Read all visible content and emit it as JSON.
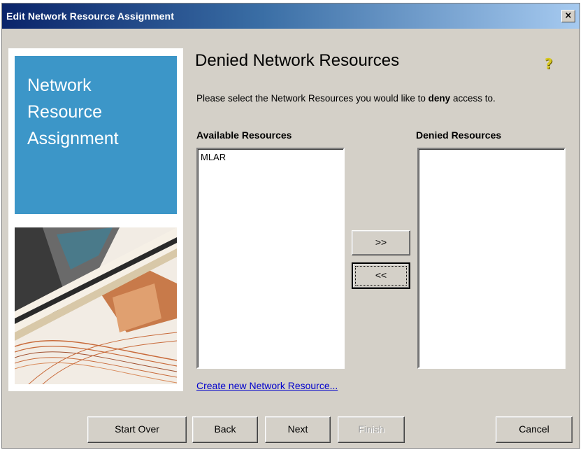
{
  "window": {
    "title": "Edit Network Resource Assignment",
    "close_glyph": "×"
  },
  "side_panel": {
    "title_lines": [
      "Network",
      "Resource",
      "Assignment"
    ]
  },
  "content": {
    "heading": "Denied Network Resources",
    "description_prefix": "Please select the Network Resources you would like to ",
    "description_bold": "deny",
    "description_suffix": " access to.",
    "available_label": "Available Resources",
    "denied_label": "Denied Resources",
    "available_items": [
      "MLAR"
    ],
    "denied_items": [],
    "add_button": ">>",
    "remove_button": "<<",
    "create_link": "Create new Network Resource..."
  },
  "footer": {
    "start_over": "Start Over",
    "back": "Back",
    "next": "Next",
    "finish": "Finish",
    "cancel": "Cancel"
  },
  "icons": {
    "help": "help-icon",
    "close": "close-icon"
  },
  "colors": {
    "title_bar_start": "#0a246a",
    "side_accent": "#3c96c8",
    "link": "#0000cc",
    "dialog_bg": "#d4d0c8"
  }
}
